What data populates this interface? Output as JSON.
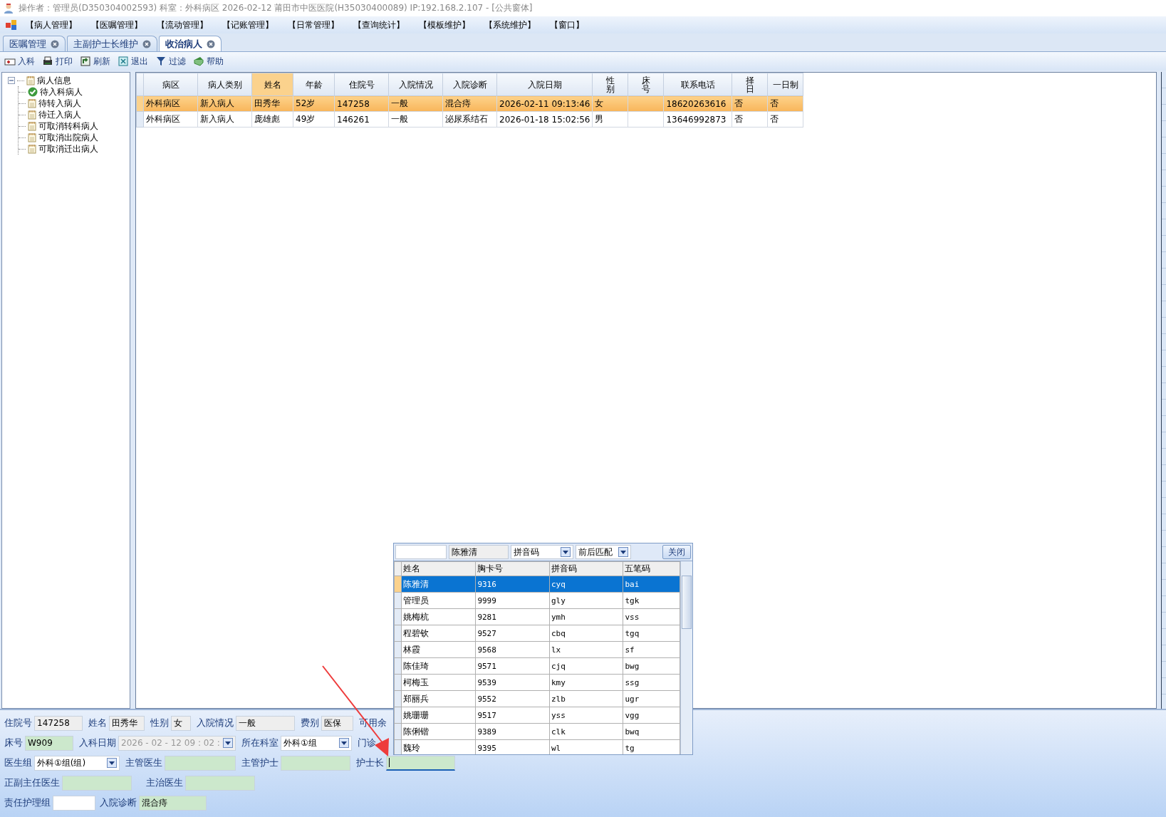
{
  "window": {
    "title": "操作者：管理员(D350304002593)  科室：外科病区  2026-02-12  莆田市中医医院(H35030400089) IP:192.168.2.107 - [公共窗体]"
  },
  "menu": [
    "【病人管理】",
    "【医嘱管理】",
    "【流动管理】",
    "【记账管理】",
    "【日常管理】",
    "【查询统计】",
    "【模板维护】",
    "【系统维护】",
    "【窗口】"
  ],
  "tabs": [
    {
      "label": "医嘱管理",
      "selected": false
    },
    {
      "label": "主副护士长维护",
      "selected": false
    },
    {
      "label": "收治病人",
      "selected": true
    }
  ],
  "toolbar": [
    {
      "label": "入科",
      "kind": "admit"
    },
    {
      "label": "打印",
      "kind": "print"
    },
    {
      "label": "刷新",
      "kind": "refresh"
    },
    {
      "label": "退出",
      "kind": "exit"
    },
    {
      "label": "过滤",
      "kind": "filter"
    },
    {
      "label": "帮助",
      "kind": "help"
    }
  ],
  "tree": {
    "label": "病人信息",
    "expanded": true,
    "children": [
      {
        "label": "待入科病人",
        "selected": true
      },
      {
        "label": "待转入病人",
        "selected": false
      },
      {
        "label": "待迁入病人",
        "selected": false
      },
      {
        "label": "可取消转科病人",
        "selected": false
      },
      {
        "label": "可取消出院病人",
        "selected": false
      },
      {
        "label": "可取消迁出病人",
        "selected": false
      }
    ]
  },
  "table": {
    "columns": [
      {
        "label": "病区",
        "selected": false
      },
      {
        "label": "病人类别",
        "selected": false
      },
      {
        "label": "姓名",
        "selected": true
      },
      {
        "label": "年龄",
        "selected": false
      },
      {
        "label": "住院号",
        "selected": false
      },
      {
        "label": "入院情况",
        "selected": false
      },
      {
        "label": "入院诊断",
        "selected": false
      },
      {
        "label": "入院日期",
        "selected": false
      },
      {
        "label": "性别",
        "selected": false
      },
      {
        "label": "床号",
        "selected": false
      },
      {
        "label": "联系电话",
        "selected": false
      },
      {
        "label": "择日",
        "selected": false
      },
      {
        "label": "一日制",
        "selected": false
      }
    ],
    "rows": [
      {
        "selected": true,
        "cells": [
          "外科病区",
          "新入病人",
          "田秀华",
          "52岁",
          "147258",
          "一般",
          "混合痔",
          "2026-02-11 09:13:46",
          "女",
          "",
          "18620263616",
          "否",
          "否"
        ]
      },
      {
        "selected": false,
        "cells": [
          "外科病区",
          "新入病人",
          "庞雄彪",
          "49岁",
          "146261",
          "一般",
          "泌尿系结石",
          "2026-01-18 15:02:56",
          "男",
          "",
          "13646992873",
          "否",
          "否"
        ]
      }
    ]
  },
  "form": {
    "lines": [
      {
        "fields": [
          {
            "label": "住院号",
            "value": "147258",
            "kind": "readonly"
          },
          {
            "label": "姓名",
            "value": "田秀华",
            "kind": "readonly"
          },
          {
            "label": "性别",
            "value": "女",
            "kind": "readonly"
          },
          {
            "label": "入院情况",
            "value": "一般",
            "kind": "readonly"
          },
          {
            "label": "费别",
            "value": "医保",
            "kind": "readonly"
          },
          {
            "label": "可用余",
            "kind": "label"
          }
        ]
      },
      {
        "fields": [
          {
            "label": "床号",
            "value": "W909",
            "kind": "required"
          },
          {
            "label": "入科日期",
            "value": "2026 - 02 - 12    09 : 02 :",
            "kind": "date"
          },
          {
            "label": "所在科室",
            "value": "外科①组",
            "kind": "select"
          },
          {
            "label": "门诊",
            "kind": "label"
          }
        ]
      },
      {
        "fields": [
          {
            "label": "医生组",
            "value": "外科①组(组)",
            "kind": "select"
          },
          {
            "label": "主管医生",
            "kind": "required"
          },
          {
            "label": "主管护士",
            "kind": "required"
          },
          {
            "label": "护士长",
            "kind": "active"
          }
        ]
      },
      {
        "fields": [
          {
            "label": "正副主任医生",
            "kind": "required"
          },
          {
            "label": "主治医生",
            "kind": "required"
          }
        ]
      },
      {
        "fields": [
          {
            "label": "责任护理组",
            "kind": "plain"
          },
          {
            "label": "入院诊断",
            "value": "混合痔",
            "kind": "required"
          }
        ]
      }
    ]
  },
  "popup": {
    "name": "陈雅清",
    "mode": "拼音码",
    "match": "前后匹配",
    "close": "关闭",
    "columns": [
      "姓名",
      "胸卡号",
      "拼音码",
      "五笔码"
    ],
    "rows": [
      {
        "selected": true,
        "cells": [
          "陈雅清",
          "9316",
          "cyq",
          "bai"
        ]
      },
      {
        "selected": false,
        "cells": [
          "管理员",
          "9999",
          "gly",
          "tgk"
        ]
      },
      {
        "selected": false,
        "cells": [
          "姚梅杭",
          "9281",
          "ymh",
          "vss"
        ]
      },
      {
        "selected": false,
        "cells": [
          "程碧钦",
          "9527",
          "cbq",
          "tgq"
        ]
      },
      {
        "selected": false,
        "cells": [
          "林霞",
          "9568",
          "lx",
          "sf"
        ]
      },
      {
        "selected": false,
        "cells": [
          "陈佳琦",
          "9571",
          "cjq",
          "bwg"
        ]
      },
      {
        "selected": false,
        "cells": [
          "柯梅玉",
          "9539",
          "kmy",
          "ssg"
        ]
      },
      {
        "selected": false,
        "cells": [
          "郑丽兵",
          "9552",
          "zlb",
          "ugr"
        ]
      },
      {
        "selected": false,
        "cells": [
          "姚珊珊",
          "9517",
          "yss",
          "vgg"
        ]
      },
      {
        "selected": false,
        "cells": [
          "陈俐锴",
          "9389",
          "clk",
          "bwq"
        ]
      },
      {
        "selected": false,
        "cells": [
          "魏玲",
          "9395",
          "wl",
          "tg"
        ]
      }
    ]
  }
}
